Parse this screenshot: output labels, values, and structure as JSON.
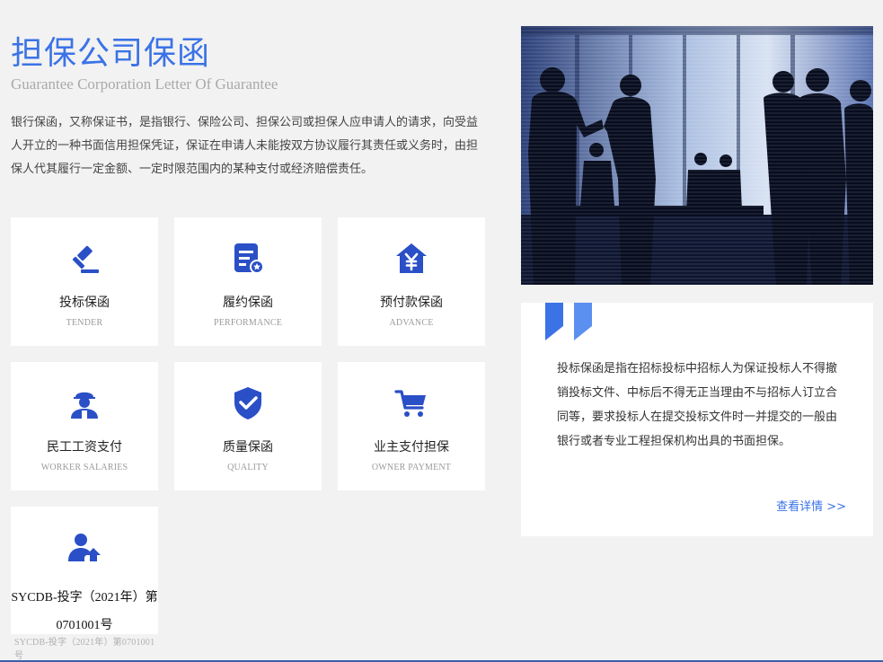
{
  "header": {
    "title": "担保公司保函",
    "subtitle": "Guarantee Corporation Letter Of Guarantee",
    "intro": "银行保函，又称保证书，是指银行、保险公司、担保公司或担保人应申请人的请求，向受益人开立的一种书面信用担保凭证，保证在申请人未能按双方协议履行其责任或义务时，由担保人代其履行一定金额、一定时限范围内的某种支付或经济赔偿责任。"
  },
  "colors": {
    "accent": "#3b73e6",
    "icon": "#2a4fc6",
    "background": "#f2f2f2"
  },
  "cards": [
    {
      "icon": "gavel-icon",
      "name": "投标保函",
      "en": "TENDER"
    },
    {
      "icon": "document-badge-icon",
      "name": "履约保函",
      "en": "PERFORMANCE"
    },
    {
      "icon": "house-yen-icon",
      "name": "预付款保函",
      "en": "ADVANCE"
    },
    {
      "icon": "worker-icon",
      "name": "民工工资支付",
      "en": "WORKER SALARIES"
    },
    {
      "icon": "shield-check-icon",
      "name": "质量保函",
      "en": "QUALITY"
    },
    {
      "icon": "shopping-cart-icon",
      "name": "业主支付担保",
      "en": "OWNER PAYMENT"
    },
    {
      "icon": "user-upload-icon",
      "name": "SYCDB-投字（2021年）第0701001号",
      "en": "SYCDB-投字（2021年）第0701001号"
    }
  ],
  "panel": {
    "text": "投标保函是指在招标投标中招标人为保证投标人不得撤销投标文件、中标后不得无正当理由不与招标人订立合同等，要求投标人在提交投标文件时一并提交的一般由银行或者专业工程担保机构出具的书面担保。",
    "more_label": "查看详情 >>"
  }
}
